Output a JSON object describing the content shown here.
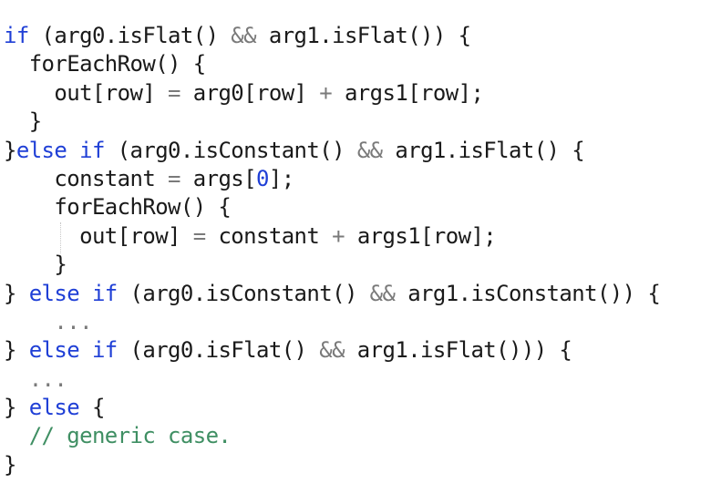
{
  "code": {
    "lines": [
      [
        {
          "t": "kw",
          "v": "if"
        },
        {
          "t": "pl",
          "v": " (arg0.isFlat() "
        },
        {
          "t": "op",
          "v": "&&"
        },
        {
          "t": "pl",
          "v": " arg1.isFlat()) {"
        }
      ],
      [
        {
          "t": "pl",
          "v": "  forEachRow() {"
        }
      ],
      [
        {
          "t": "pl",
          "v": "    out[row] "
        },
        {
          "t": "op",
          "v": "="
        },
        {
          "t": "pl",
          "v": " arg0[row] "
        },
        {
          "t": "op",
          "v": "+"
        },
        {
          "t": "pl",
          "v": " args1[row];"
        }
      ],
      [
        {
          "t": "pl",
          "v": "  }"
        }
      ],
      [
        {
          "t": "pl",
          "v": "}"
        },
        {
          "t": "kw",
          "v": "else if"
        },
        {
          "t": "pl",
          "v": " (arg0.isConstant() "
        },
        {
          "t": "op",
          "v": "&&"
        },
        {
          "t": "pl",
          "v": " arg1.isFlat() {"
        }
      ],
      [
        {
          "t": "pl",
          "v": "    constant "
        },
        {
          "t": "op",
          "v": "="
        },
        {
          "t": "pl",
          "v": " args["
        },
        {
          "t": "num",
          "v": "0"
        },
        {
          "t": "pl",
          "v": "];"
        }
      ],
      [
        {
          "t": "pl",
          "v": "    forEachRow() {"
        }
      ],
      [
        {
          "t": "pl",
          "v": "      out[row] "
        },
        {
          "t": "op",
          "v": "="
        },
        {
          "t": "pl",
          "v": " constant "
        },
        {
          "t": "op",
          "v": "+"
        },
        {
          "t": "pl",
          "v": " args1[row];"
        }
      ],
      [
        {
          "t": "pl",
          "v": "    }"
        }
      ],
      [
        {
          "t": "pl",
          "v": "} "
        },
        {
          "t": "kw",
          "v": "else if"
        },
        {
          "t": "pl",
          "v": " (arg0.isConstant() "
        },
        {
          "t": "op",
          "v": "&&"
        },
        {
          "t": "pl",
          "v": " arg1.isConstant()) {"
        }
      ],
      [
        {
          "t": "dim",
          "v": "    ..."
        }
      ],
      [
        {
          "t": "pl",
          "v": "} "
        },
        {
          "t": "kw",
          "v": "else if"
        },
        {
          "t": "pl",
          "v": " (arg0.isFlat() "
        },
        {
          "t": "op",
          "v": "&&"
        },
        {
          "t": "pl",
          "v": " arg1.isFlat())) {"
        }
      ],
      [
        {
          "t": "dim",
          "v": "  ..."
        }
      ],
      [
        {
          "t": "pl",
          "v": "} "
        },
        {
          "t": "kw",
          "v": "else"
        },
        {
          "t": "pl",
          "v": " {"
        }
      ],
      [
        {
          "t": "cm",
          "v": "  // generic case."
        }
      ],
      [
        {
          "t": "pl",
          "v": "}"
        }
      ]
    ]
  }
}
